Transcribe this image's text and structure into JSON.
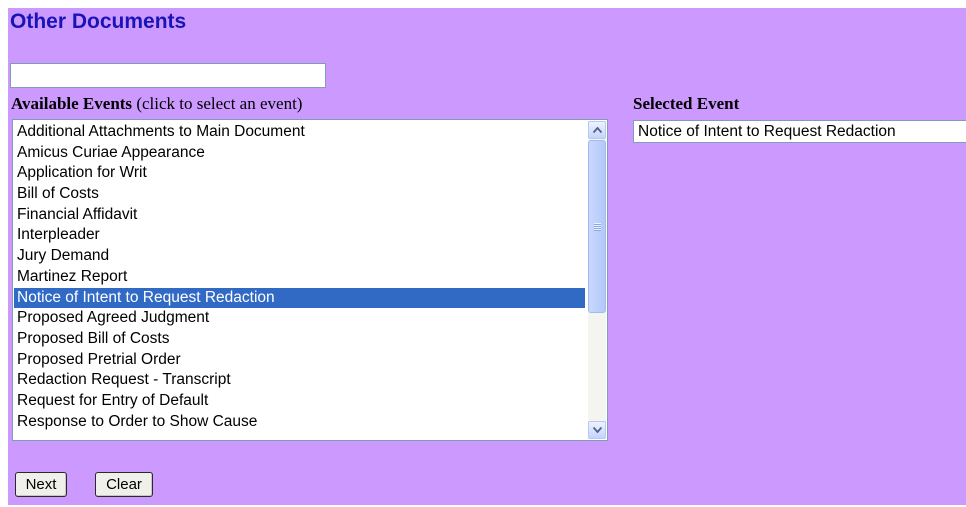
{
  "page": {
    "title": "Other Documents"
  },
  "search": {
    "value": ""
  },
  "available_events": {
    "label_bold": "Available Events",
    "label_hint": " (click to select an event)",
    "items": [
      "Additional Attachments to Main Document",
      "Amicus Curiae Appearance",
      "Application for Writ",
      "Bill of Costs",
      "Financial Affidavit",
      "Interpleader",
      "Jury Demand",
      "Martinez Report",
      "Notice of Intent to Request Redaction",
      "Proposed Agreed Judgment",
      "Proposed Bill of Costs",
      "Proposed Pretrial Order",
      "Redaction Request - Transcript",
      "Request for Entry of Default",
      "Response to Order to Show Cause"
    ],
    "selected_index": 8
  },
  "selected_event": {
    "label": "Selected Event",
    "value": "Notice of Intent to Request Redaction"
  },
  "buttons": {
    "next": "Next",
    "clear": "Clear"
  },
  "colors": {
    "background": "#cc99ff",
    "title": "#1a14b8",
    "selection": "#316ac5"
  },
  "icons": {
    "scroll_up": "arrow-up-icon",
    "scroll_down": "arrow-down-icon"
  }
}
